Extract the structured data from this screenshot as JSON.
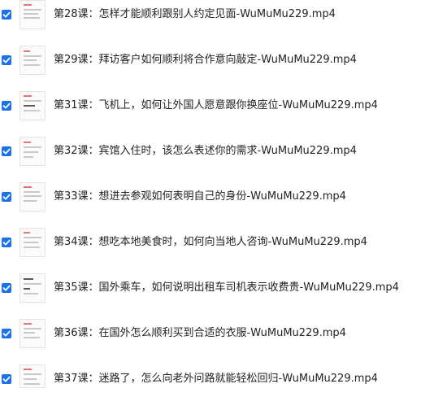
{
  "files": [
    {
      "name": "第28课：怎样才能顺利跟别人约定见面-WuMuMu229.mp4",
      "checked": true
    },
    {
      "name": "第29课：拜访客户如何顺利将合作意向敲定-WuMuMu229.mp4",
      "checked": true
    },
    {
      "name": "第31课：飞机上，如何让外国人愿意跟你换座位-WuMuMu229.mp4",
      "checked": true
    },
    {
      "name": "第32课：宾馆入住时，该怎么表述你的需求-WuMuMu229.mp4",
      "checked": true
    },
    {
      "name": "第33课：想进去参观如何表明自己的身份-WuMuMu229.mp4",
      "checked": true
    },
    {
      "name": "第34课：想吃本地美食时，如何向当地人咨询-WuMuMu229.mp4",
      "checked": true
    },
    {
      "name": "第35课：国外乘车，如何说明出租车司机表示收费贵-WuMuMu229.mp4",
      "checked": true
    },
    {
      "name": "第36课：在国外怎么顺利买到合适的衣服-WuMuMu229.mp4",
      "checked": true
    },
    {
      "name": "第37课：迷路了，怎么向老外问路就能轻松回归-WuMuMu229.mp4",
      "checked": true
    }
  ],
  "icons": {
    "checkbox": "checkbox-checked-icon",
    "thumbnail": "video-thumbnail"
  },
  "colors": {
    "checkbox": "#1a73e8",
    "text": "#222222"
  }
}
